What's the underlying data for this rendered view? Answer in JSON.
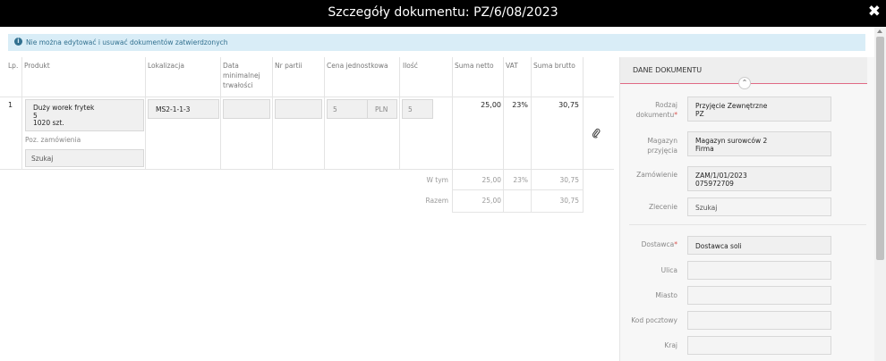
{
  "title": "Szczegóły dokumentu: PZ/6/08/2023",
  "alert": {
    "text": "Nie można edytować i usuwać dokumentów zatwierdzonych"
  },
  "table": {
    "headers": {
      "lp": "Lp.",
      "produkt": "Produkt",
      "lokalizacja": "Lokalizacja",
      "data_line1": "Data",
      "data_line2": "minimalnej",
      "data_line3": "trwałości",
      "nr_partii": "Nr partii",
      "cena": "Cena jednostkowa",
      "ilosc": "Ilość",
      "suma_netto": "Suma netto",
      "vat": "VAT",
      "suma_brutto": "Suma brutto"
    },
    "row": {
      "lp": "1",
      "product_name": "Duży worek frytek",
      "product_qty": "5",
      "product_pcs": "1020 szt.",
      "lokalizacja": "MS2-1-1-3",
      "cena": "5",
      "currency": "PLN",
      "ilosc": "5",
      "suma_netto": "25,00",
      "vat": "23%",
      "suma_brutto": "30,75",
      "poz_label": "Poz. zamówienia",
      "search": "Szukaj"
    },
    "summary": {
      "wtym_label": "W tym",
      "wtym_netto": "25,00",
      "wtym_vat": "23%",
      "wtym_brutto": "30,75",
      "razem_label": "Razem",
      "razem_netto": "25,00",
      "razem_brutto": "30,75"
    }
  },
  "panel": {
    "header": "DANE DOKUMENTU",
    "rodzaj_label_1": "Rodzaj",
    "rodzaj_label_2": "dokumentu",
    "rodzaj_value_1": "Przyjęcie Zewnętrzne",
    "rodzaj_value_2": "PZ",
    "magazyn_label_1": "Magazyn",
    "magazyn_label_2": "przyjęcia",
    "magazyn_value_1": "Magazyn surowców 2",
    "magazyn_value_2": "Firma",
    "zamowienie_label": "Zamówienie",
    "zamowienie_value_1": "ZAM/1/01/2023",
    "zamowienie_value_2": "075972709",
    "zlecenie_label": "Zlecenie",
    "zlecenie_placeholder": "Szukaj",
    "dostawca_label": "Dostawca",
    "dostawca_value": "Dostawca soli",
    "ulica_label": "Ulica",
    "miasto_label": "Miasto",
    "kod_label": "Kod pocztowy",
    "kraj_label": "Kraj"
  },
  "icons": {
    "close": "close-icon",
    "info": "info-icon",
    "attachment": "paperclip-icon",
    "collapse": "chevron-up-icon"
  },
  "colors": {
    "topbar": "#000000",
    "alert_bg": "#d9edf7",
    "alert_text": "#31708f",
    "accent": "#e06a85",
    "required": "#d9534f"
  }
}
